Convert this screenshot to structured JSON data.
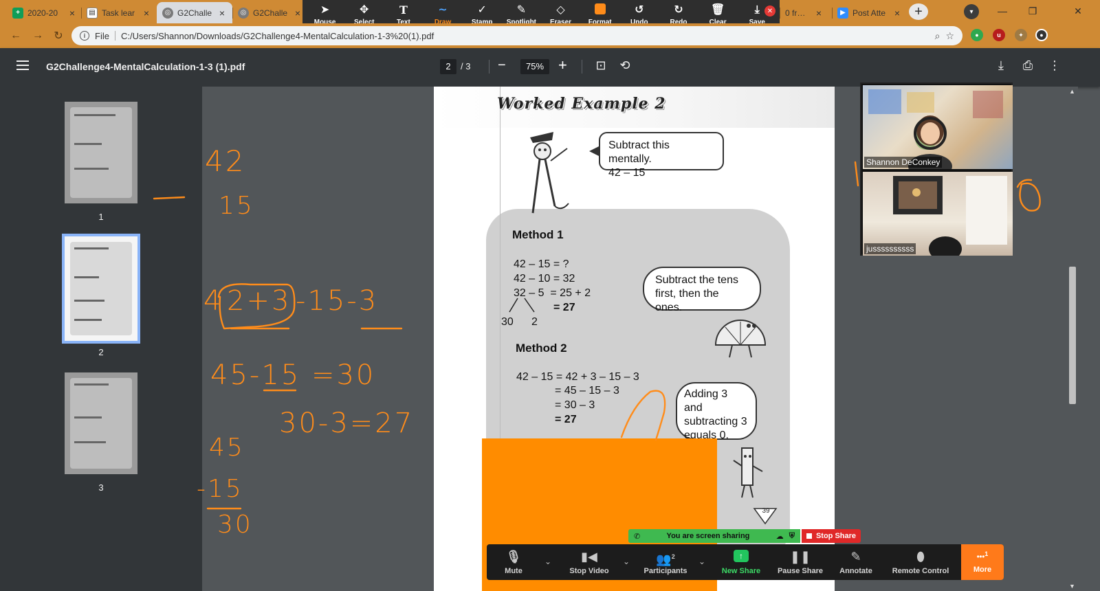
{
  "browser": {
    "tabs": [
      {
        "title": "2020-20",
        "favicon": "sheets-icon"
      },
      {
        "title": "Task lear",
        "favicon": "task-icon"
      },
      {
        "title": "G2Challe",
        "favicon": "globe-icon",
        "active": true
      },
      {
        "title": "G2Challe",
        "favicon": "globe-icon"
      },
      {
        "title": "0 frame",
        "favicon": "none"
      },
      {
        "title": "Post Atte",
        "favicon": "zoom-icon"
      }
    ],
    "address": {
      "scheme_label": "File",
      "url": "C:/Users/Shannon/Downloads/G2Challenge4-MentalCalculation-1-3%20(1).pdf"
    },
    "accent_color": "#cf8a34"
  },
  "annotate_toolbar": {
    "tools": [
      {
        "label": "Mouse",
        "icon": "cursor-icon"
      },
      {
        "label": "Select",
        "icon": "move-icon"
      },
      {
        "label": "Text",
        "icon": "text-icon"
      },
      {
        "label": "Draw",
        "icon": "draw-icon",
        "active": true
      },
      {
        "label": "Stamp",
        "icon": "check-icon"
      },
      {
        "label": "Spotlight",
        "icon": "spotlight-icon"
      },
      {
        "label": "Eraser",
        "icon": "eraser-icon"
      },
      {
        "label": "Format",
        "icon": "color-swatch"
      },
      {
        "label": "Undo",
        "icon": "undo-icon"
      },
      {
        "label": "Redo",
        "icon": "redo-icon"
      },
      {
        "label": "Clear",
        "icon": "trash-icon"
      },
      {
        "label": "Save",
        "icon": "save-icon"
      }
    ],
    "format_color": "#ff8c1a"
  },
  "pdf_viewer": {
    "filename": "G2Challenge4-MentalCalculation-1-3 (1).pdf",
    "current_page": "2",
    "page_total": "/ 3",
    "zoom": "75%",
    "thumbnails": [
      {
        "label": "1"
      },
      {
        "label": "2",
        "selected": true
      },
      {
        "label": "3"
      }
    ]
  },
  "document": {
    "heading": "Worked Example 2",
    "bubble_prompt": [
      "Subtract this mentally.",
      "42 – 15"
    ],
    "method1": {
      "title": "Method 1",
      "lines": [
        "42 – 15 = ?",
        "42 – 10 = 32",
        "32 – 5  = 25 + 2",
        "= 27"
      ],
      "split_left": "30",
      "split_right": "2"
    },
    "bubble_tip1": [
      "Subtract the tens",
      "first, then the ones."
    ],
    "method2": {
      "title": "Method 2",
      "lines": [
        "42 – 15 = 42 + 3 – 15 – 3",
        "= 45 – 15 – 3",
        "= 30 – 3",
        "= 27"
      ]
    },
    "bubble_tip2": [
      "Adding 3 and",
      "subtracting 3",
      "equals 0."
    ],
    "page_number": "39"
  },
  "handwriting": {
    "n42": "42",
    "n15": "15",
    "expr_lead": "4",
    "expr_box": "2+3",
    "expr_tail": "-15-3",
    "eq1": "45-15 =30",
    "eq2": "30-3=27",
    "col_top": "45",
    "col_mid": "-15",
    "col_bottom": "30",
    "ink_color": "#ff8c1a"
  },
  "zoom": {
    "participants": [
      {
        "name": "Shannon DeConkey"
      },
      {
        "name": "jussssssssss"
      }
    ],
    "sharing_banner": "You are screen sharing",
    "stop_share": "Stop Share",
    "controls": [
      {
        "label": "Mute",
        "icon": "microphone-icon"
      },
      {
        "label": "Stop Video",
        "icon": "video-camera-icon"
      },
      {
        "label": "Participants",
        "icon": "participants-icon",
        "badge": "2"
      },
      {
        "label": "New Share",
        "icon": "share-arrow-icon"
      },
      {
        "label": "Pause Share",
        "icon": "pause-icon"
      },
      {
        "label": "Annotate",
        "icon": "pencil-icon"
      },
      {
        "label": "Remote Control",
        "icon": "mouse-icon"
      }
    ],
    "more": {
      "label": "More",
      "badge": "1"
    }
  }
}
